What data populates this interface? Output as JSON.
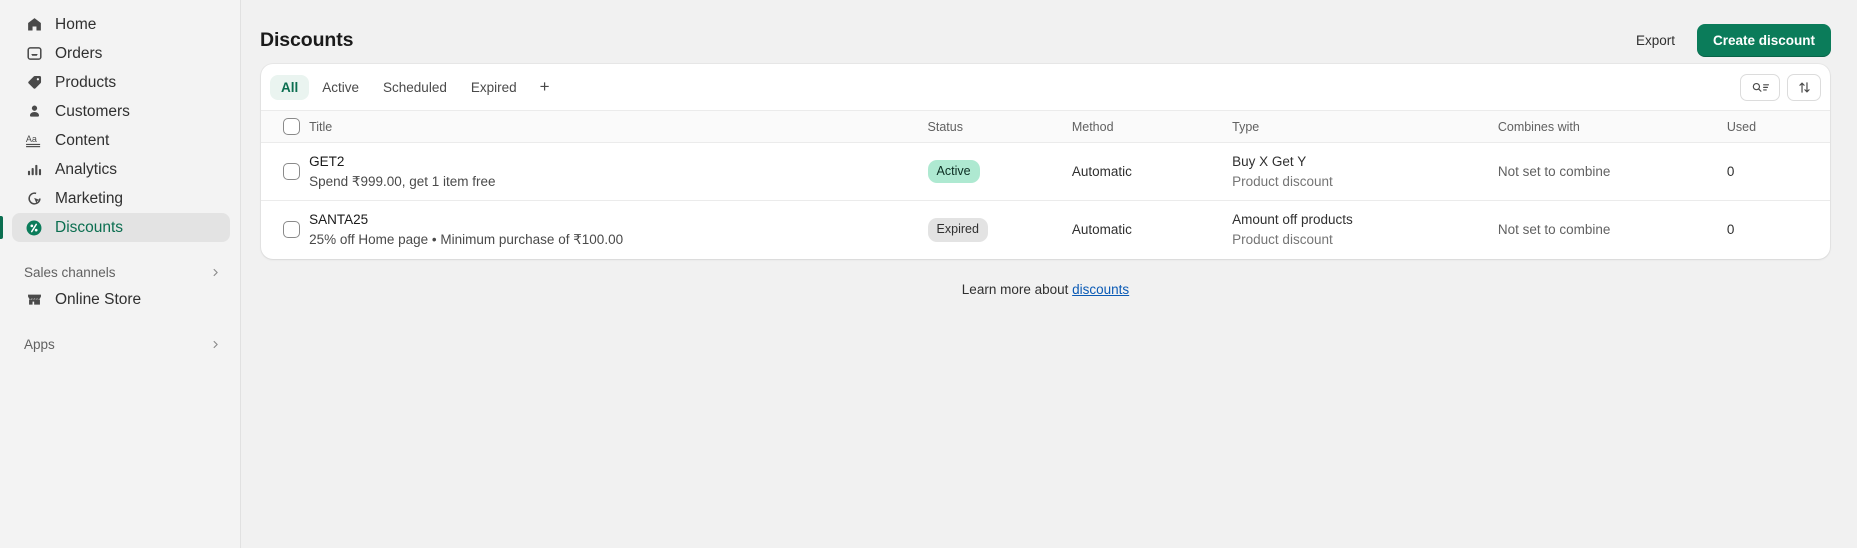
{
  "sidebar": {
    "items": [
      {
        "label": "Home",
        "icon": "home-icon",
        "active": false
      },
      {
        "label": "Orders",
        "icon": "orders-icon",
        "active": false
      },
      {
        "label": "Products",
        "icon": "products-icon",
        "active": false
      },
      {
        "label": "Customers",
        "icon": "customers-icon",
        "active": false
      },
      {
        "label": "Content",
        "icon": "content-icon",
        "active": false
      },
      {
        "label": "Analytics",
        "icon": "analytics-icon",
        "active": false
      },
      {
        "label": "Marketing",
        "icon": "marketing-icon",
        "active": false
      },
      {
        "label": "Discounts",
        "icon": "discount-icon",
        "active": true
      }
    ],
    "sales_channels_label": "Sales channels",
    "online_store_label": "Online Store",
    "apps_label": "Apps"
  },
  "header": {
    "title": "Discounts",
    "export_label": "Export",
    "create_label": "Create discount"
  },
  "filters": {
    "tabs": [
      {
        "label": "All",
        "selected": true
      },
      {
        "label": "Active",
        "selected": false
      },
      {
        "label": "Scheduled",
        "selected": false
      },
      {
        "label": "Expired",
        "selected": false
      }
    ],
    "add_view_label": "+",
    "search_button": "search-filter-icon",
    "sort_button": "sort-icon"
  },
  "table": {
    "columns": [
      "Title",
      "Status",
      "Method",
      "Type",
      "Combines with",
      "Used"
    ],
    "rows": [
      {
        "title": "GET2",
        "subtitle": "Spend ₹999.00, get 1 item free",
        "status": "Active",
        "status_tone": "success",
        "method": "Automatic",
        "type": "Buy X Get Y",
        "type_sub": "Product discount",
        "combines_with": "Not set to combine",
        "used": "0"
      },
      {
        "title": "SANTA25",
        "subtitle": "25% off Home page • Minimum purchase of ₹100.00",
        "status": "Expired",
        "status_tone": "neutral",
        "method": "Automatic",
        "type": "Amount off products",
        "type_sub": "Product discount",
        "combines_with": "Not set to combine",
        "used": "0"
      }
    ]
  },
  "footer": {
    "learn_more_text": "Learn more about",
    "learn_more_link": "discounts"
  },
  "colors": {
    "brand_green": "#0b7c5a",
    "active_nav_green": "#0b6e50",
    "badge_success_bg": "#aee9d1",
    "badge_neutral_bg": "#e3e3e3",
    "link_blue": "#0a5ab5",
    "page_bg": "#f1f1f1"
  }
}
